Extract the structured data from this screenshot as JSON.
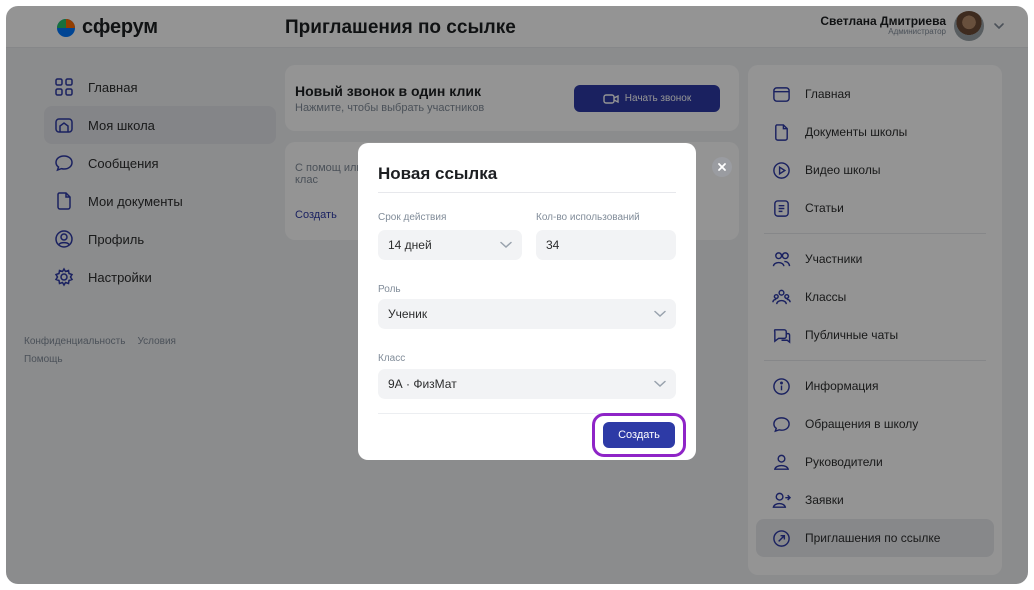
{
  "header": {
    "logo_text": "сферум",
    "page_title": "Приглашения по ссылке",
    "user_name": "Светлана Дмитриева",
    "user_role": "Администратор"
  },
  "left_nav": {
    "items": [
      {
        "label": "Главная",
        "icon": "grid-icon"
      },
      {
        "label": "Моя школа",
        "icon": "school-icon",
        "active": true
      },
      {
        "label": "Сообщения",
        "icon": "chat-bubble-icon"
      },
      {
        "label": "Мои документы",
        "icon": "document-icon"
      },
      {
        "label": "Профиль",
        "icon": "profile-icon"
      },
      {
        "label": "Настройки",
        "icon": "gear-icon"
      }
    ],
    "footer": [
      "Конфиденциальность",
      "Условия",
      "Помощь"
    ]
  },
  "call_card": {
    "title": "Новый звонок в один клик",
    "subtitle": "Нажмите, чтобы выбрать участников",
    "button": "Начать звонок"
  },
  "invite_card": {
    "text": "С помощ или клас",
    "link": "Создать"
  },
  "right_nav": {
    "groups": [
      [
        {
          "label": "Главная",
          "icon": "browser-icon"
        },
        {
          "label": "Документы школы",
          "icon": "document-icon"
        },
        {
          "label": "Видео школы",
          "icon": "play-circle-icon"
        },
        {
          "label": "Статьи",
          "icon": "article-icon"
        }
      ],
      [
        {
          "label": "Участники",
          "icon": "users-icon"
        },
        {
          "label": "Классы",
          "icon": "classes-icon"
        },
        {
          "label": "Публичные чаты",
          "icon": "chats-icon"
        }
      ],
      [
        {
          "label": "Информация",
          "icon": "info-icon"
        },
        {
          "label": "Обращения в школу",
          "icon": "chat-bubble-icon"
        },
        {
          "label": "Руководители",
          "icon": "person-icon"
        },
        {
          "label": "Заявки",
          "icon": "person-add-icon"
        },
        {
          "label": "Приглашения по ссылке",
          "icon": "link-circle-icon",
          "active": true
        }
      ]
    ]
  },
  "modal": {
    "title": "Новая ссылка",
    "expiry_label": "Срок действия",
    "expiry_value": "14 дней",
    "uses_label": "Кол-во использований",
    "uses_value": "34",
    "role_label": "Роль",
    "role_value": "Ученик",
    "class_label": "Класс",
    "class_value": "9А · ФизМат",
    "create_button": "Создать"
  },
  "colors": {
    "primary": "#2d3aa6",
    "highlight": "#8e24c7",
    "logo_blue": "#0077ff",
    "logo_orange": "#ff6b00"
  }
}
